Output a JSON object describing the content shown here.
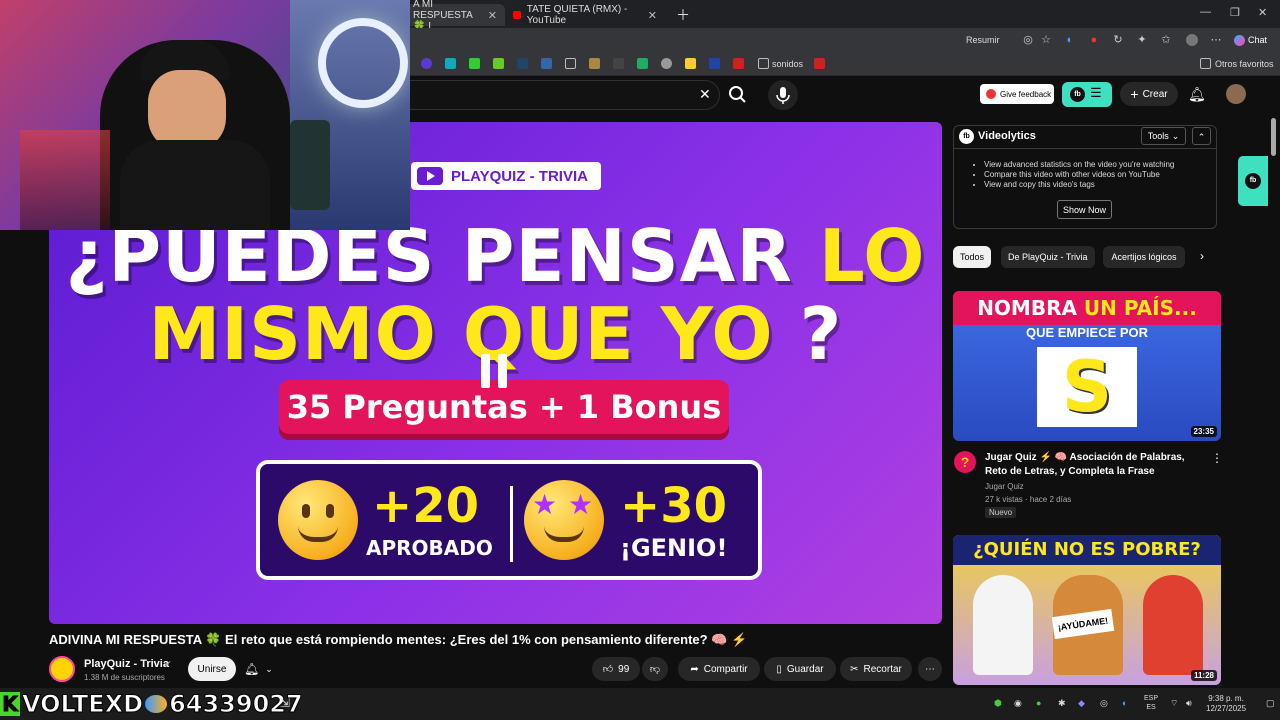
{
  "browser": {
    "tabs": [
      {
        "label": "A MI RESPUESTA 🍀 I"
      },
      {
        "label": "TATE QUIETA (RMX) - YouTube"
      }
    ],
    "toolbar": {
      "resumir": "Resumir",
      "chat": "Chat"
    },
    "bookmarks": {
      "sonidos": "sonidos",
      "otros": "Otros favoritos"
    }
  },
  "yt_header": {
    "feedback": "Give feedback",
    "crear": "Crear"
  },
  "video": {
    "badge": "PLAYQUIZ - TRIVIA",
    "line1_a": "¿PUEDES PENSAR ",
    "line1_b": "LO",
    "line2_a": "MISMO QUE YO ",
    "line2_b": "?",
    "pill": "35 Preguntas + 1 Bonus",
    "left_score": "+20",
    "left_label": "APROBADO",
    "right_score": "+30",
    "right_label": "¡GENIO!"
  },
  "meta": {
    "title": "ADIVINA MI RESPUESTA 🍀 El reto que está rompiendo mentes: ¿Eres del 1% con pensamiento diferente? 🧠 ⚡",
    "channel": "PlayQuiz - Trivia",
    "subs": "1.38 M de suscriptores",
    "join": "Unirse",
    "likes": "99",
    "share": "Compartir",
    "save": "Guardar",
    "clip": "Recortar"
  },
  "videolytics": {
    "name": "Videolytics",
    "tools": "Tools",
    "bullets": [
      "View advanced statistics on the video you're watching",
      "Compare this video with other videos on YouTube",
      "View and copy this video's tags"
    ],
    "show_now": "Show Now"
  },
  "chips": [
    "Todos",
    "De PlayQuiz - Trivia",
    "Acertijos lógicos"
  ],
  "related": [
    {
      "thumb_top_a": "NOMBRA ",
      "thumb_top_b": "UN PAÍS...",
      "thumb_sub": "QUE EMPIECE POR",
      "thumb_letter": "S",
      "duration": "23:35",
      "title": "Jugar Quiz ⚡ 🧠 Asociación de Palabras, Reto de Letras, y Completa la Frase",
      "channel": "Jugar Quiz",
      "meta": "27 k vistas · hace 2 días",
      "badge": "Nuevo"
    },
    {
      "thumb_top": "¿QUIÉN NO ES POBRE?",
      "sign": "¡AYÚDAME!",
      "duration": "11:28"
    }
  ],
  "stream_overlay": {
    "name": "VOLTEXD",
    "number": "64339027"
  },
  "taskbar": {
    "lang_1": "ESP",
    "lang_2": "ES",
    "time": "9:38 p. m.",
    "date": "12/27/2025"
  },
  "colors": {
    "accent_yellow": "#ffe81a",
    "accent_pink": "#e3135c",
    "purple": "#6b1bd0",
    "teal": "#3fe0c0"
  }
}
